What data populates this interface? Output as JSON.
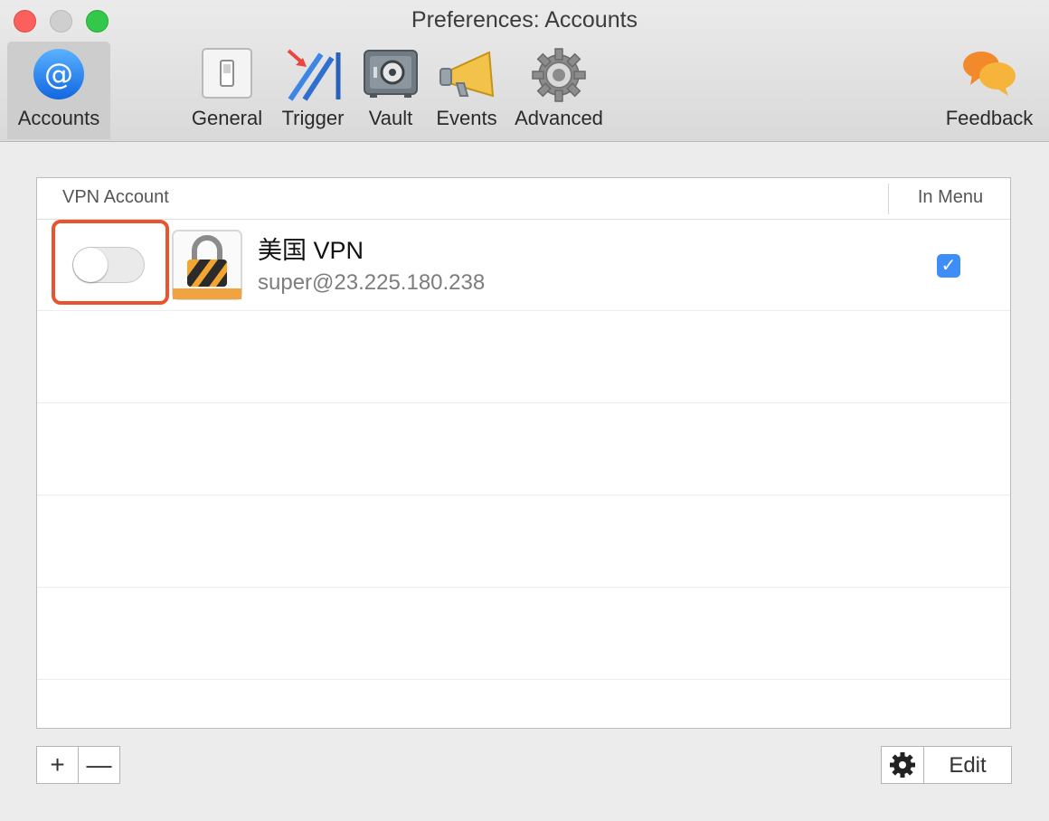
{
  "window": {
    "title": "Preferences: Accounts"
  },
  "toolbar": {
    "items": [
      {
        "label": "Accounts",
        "icon": "at-icon",
        "selected": true
      },
      {
        "label": "General",
        "icon": "switch-icon"
      },
      {
        "label": "Trigger",
        "icon": "trigger-icon"
      },
      {
        "label": "Vault",
        "icon": "vault-icon"
      },
      {
        "label": "Events",
        "icon": "megaphone-icon"
      },
      {
        "label": "Advanced",
        "icon": "gear-icon"
      },
      {
        "label": "Feedback",
        "icon": "speech-bubbles-icon"
      }
    ]
  },
  "table": {
    "columns": {
      "account": "VPN Account",
      "in_menu": "In Menu"
    },
    "rows": [
      {
        "name": "美国 VPN",
        "address": "super@23.225.180.238",
        "enabled": false,
        "in_menu": true,
        "icon": "lock-icon"
      }
    ]
  },
  "footer": {
    "add_label": "+",
    "remove_label": "—",
    "edit_label": "Edit"
  },
  "colors": {
    "highlight": "#e8542d",
    "checkbox": "#3f8ef7",
    "accounts_icon": "#1d7cf2"
  }
}
